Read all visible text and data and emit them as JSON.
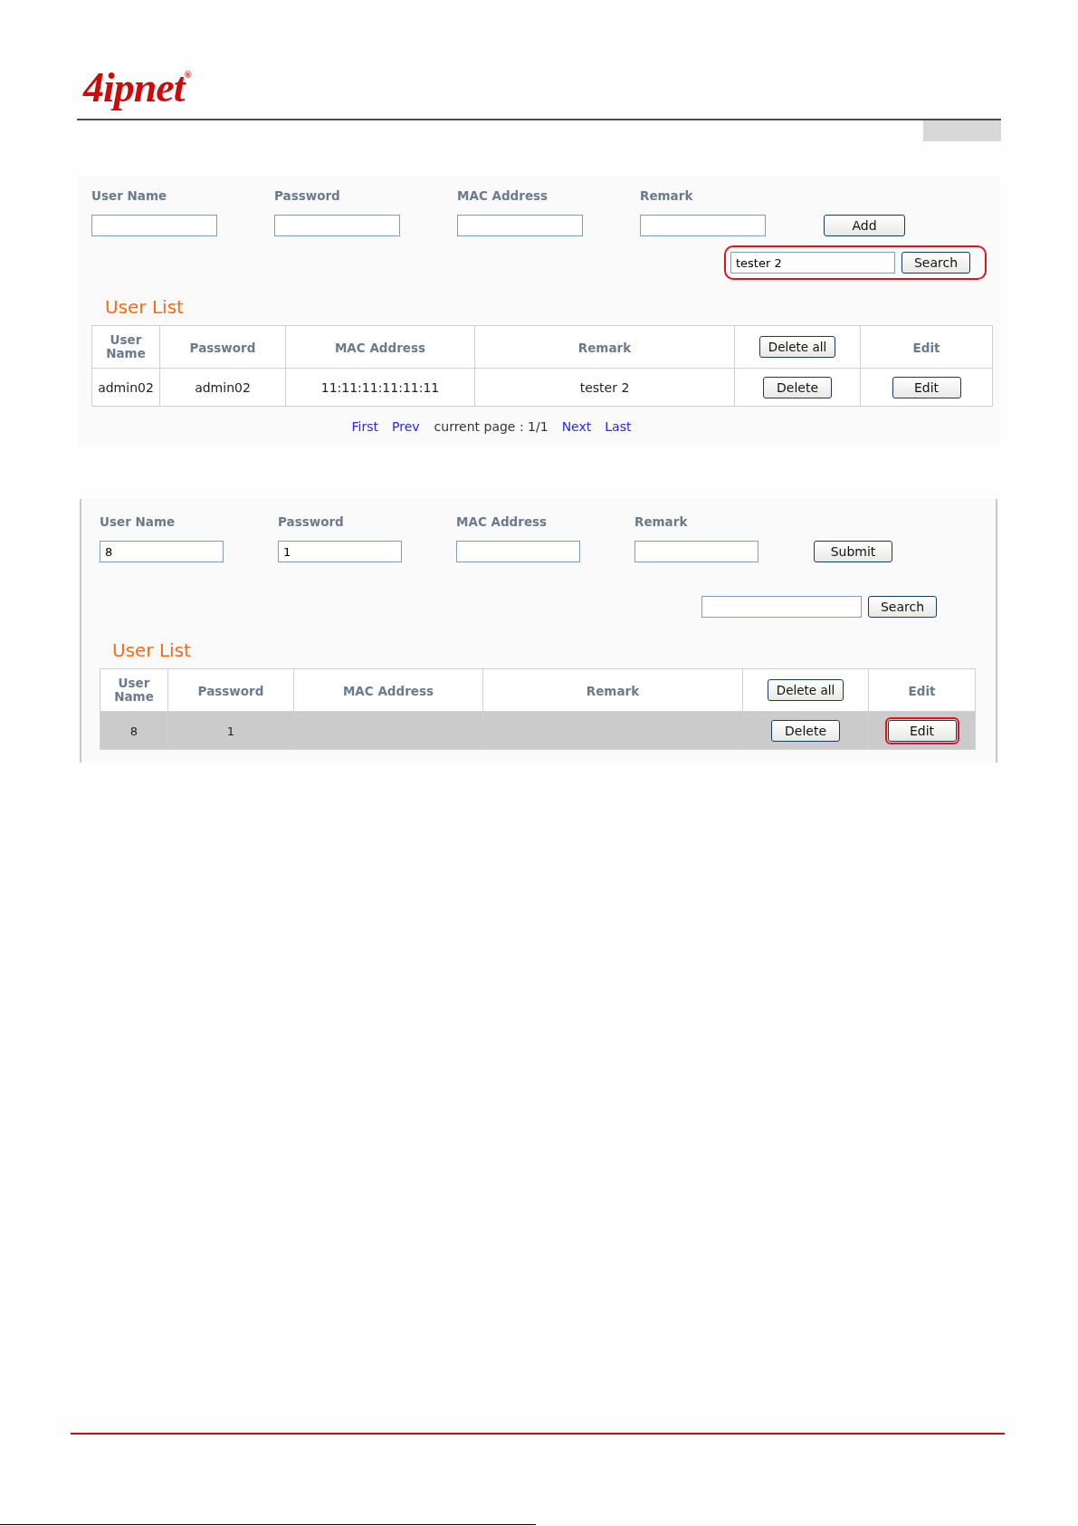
{
  "header": {
    "logo": "4ipnet$^{®}$"
  },
  "screens": [
    {
      "cut_off": false,
      "fields": [
        {
          "label": "User Name"
        },
        {
          "label": "Password"
        },
        {
          "label": "MAC Address"
        },
        {
          "label": "Remark"
        }
      ],
      "action_button": "Add",
      "search": {
        "value": "tester 2",
        "highlighted": true,
        "button": "Search"
      },
      "list_title": "User List",
      "columns": [
        {
          "kind": "text",
          "label": "User Name"
        },
        {
          "kind": "text",
          "label": "Password"
        },
        {
          "kind": "text",
          "label": "MAC Address"
        },
        {
          "kind": "text",
          "label": "Remark"
        },
        {
          "kind": "button",
          "label": "Delete all"
        },
        {
          "kind": "text",
          "label": "Edit"
        }
      ],
      "rows": [
        {
          "selected": false,
          "cells": [
            "admin02",
            "admin02",
            "11:11:11:11:11:11",
            "tester 2"
          ],
          "delete_button": "Delete",
          "edit_button": "Edit",
          "edit_highlighted": false
        }
      ],
      "pagination": [
        {
          "kind": "link",
          "label": "First"
        },
        {
          "kind": "link",
          "label": "Prev"
        },
        {
          "kind": "text",
          "label": "current page : 1/1"
        },
        {
          "kind": "link",
          "label": "Next"
        },
        {
          "kind": "link",
          "label": "Last"
        }
      ]
    },
    {
      "cut_off": true,
      "fields": [
        {
          "label": "User Name",
          "value": "8"
        },
        {
          "label": "Password",
          "value": "1"
        },
        {
          "label": "MAC Address"
        },
        {
          "label": "Remark"
        }
      ],
      "action_button": "Submit",
      "search": {
        "highlighted": false,
        "button": "Search"
      },
      "list_title": "User List",
      "columns": [
        {
          "kind": "text",
          "label": "User Name"
        },
        {
          "kind": "text",
          "label": "Password"
        },
        {
          "kind": "text",
          "label": "MAC Address"
        },
        {
          "kind": "text",
          "label": "Remark"
        },
        {
          "kind": "button",
          "label": "Delete all"
        },
        {
          "kind": "text",
          "label": "Edit"
        }
      ],
      "rows": [
        {
          "selected": true,
          "cells": [
            "8",
            "1"
          ],
          "delete_button": "Delete",
          "edit_button": "Edit",
          "edit_highlighted": true
        }
      ]
    }
  ]
}
